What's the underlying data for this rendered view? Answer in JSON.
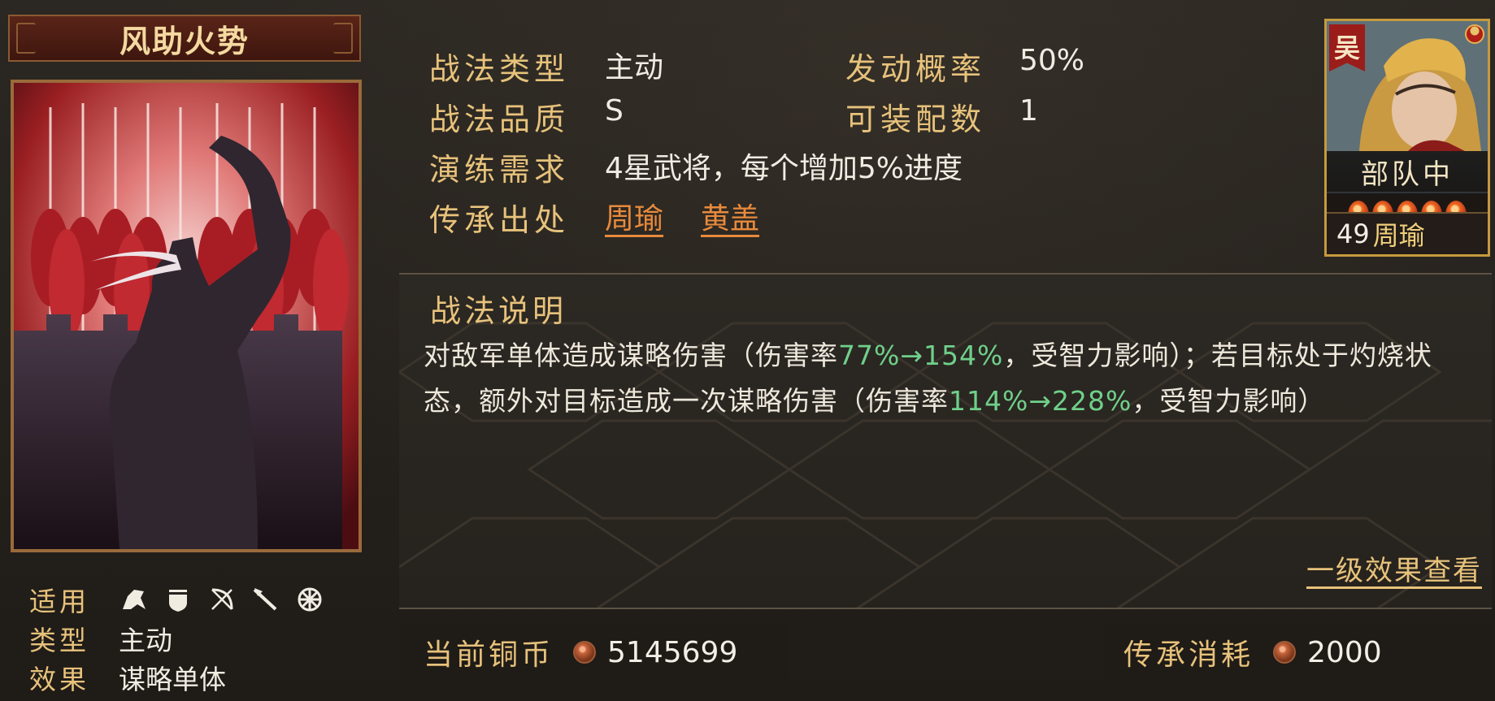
{
  "skill": {
    "name": "风助火势",
    "applicable_label": "适用",
    "applicable_icons": [
      "cavalry-icon",
      "shield-icon",
      "bow-icon",
      "spear-icon",
      "siege-icon"
    ],
    "type_label": "类型",
    "type_value": "主动",
    "effect_label": "效果",
    "effect_value": "谋略单体"
  },
  "info": {
    "tactic_type_label": "战法类型",
    "tactic_type_value": "主动",
    "trigger_rate_label": "发动概率",
    "trigger_rate_value": "50%",
    "quality_label": "战法品质",
    "quality_value": "S",
    "equip_count_label": "可装配数",
    "equip_count_value": "1",
    "training_label": "演练需求",
    "training_value": "4星武将，每个增加5%进度",
    "inherit_label": "传承出处",
    "inherit_sources": [
      "周瑜",
      "黄盖"
    ]
  },
  "hero": {
    "faction": "吴",
    "position": "部队中",
    "stars": 5,
    "level": "49",
    "name": "周瑜"
  },
  "description": {
    "title": "战法说明",
    "part1": "对敌军单体造成谋略伤害（伤害率",
    "rate1": "77%→154%",
    "part2": "，受智力影响）；若目标处于灼烧状态，额外对目标造成一次谋略伤害（伤害率",
    "rate2": "114%→228%",
    "part3": "，受智力影响）",
    "view_link": "一级效果查看"
  },
  "currency": {
    "current_label": "当前铜币",
    "current_value": "5145699",
    "cost_label": "传承消耗",
    "cost_value": "2000"
  },
  "colors": {
    "gold_label": "#e7c27b",
    "link_orange": "#e88a3c",
    "rate_green": "#6fd08a",
    "panel_bg": "#26221d"
  }
}
